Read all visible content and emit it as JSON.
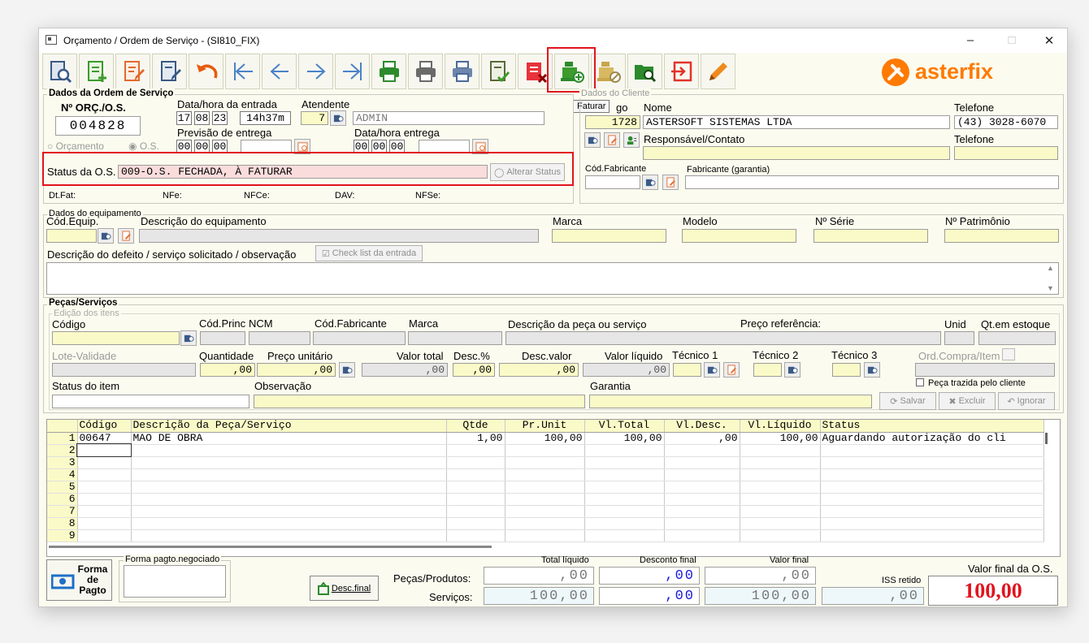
{
  "window": {
    "title": "Orçamento / Ordem de Serviço - (SI810_FIX)"
  },
  "toolbar": {
    "buttons": [
      "search-doc",
      "new-doc",
      "edit-doc",
      "save-doc",
      "undo",
      "first",
      "prev",
      "next",
      "last",
      "print-green",
      "print-gray",
      "print-blue",
      "check-doc",
      "delete-doc",
      "faturar",
      "cancel-billing",
      "search-folder",
      "exit",
      "pencil"
    ],
    "tooltip": "Faturar"
  },
  "brand": {
    "name": "asterfix",
    "color": "#ff7a00"
  },
  "os": {
    "group_title": "Dados da Ordem de Serviço",
    "number_label": "Nº ORÇ./O.S.",
    "number": "004828",
    "radio_orcamento": "Orçamento",
    "radio_os": "O.S.",
    "entry_label": "Data/hora da entrada",
    "entry_day": "17",
    "entry_month": "08",
    "entry_year": "23",
    "entry_time": "14h37m",
    "atendente_label": "Atendente",
    "atendente_code": "7",
    "atendente_name": "ADMIN",
    "previsao_label": "Previsão de entrega",
    "previsao_day": "00",
    "previsao_month": "00",
    "previsao_year": "00",
    "entrega_label": "Data/hora entrega",
    "entrega_day": "00",
    "entrega_month": "00",
    "entrega_year": "00",
    "status_label": "Status da O.S.",
    "status_value": "009-O.S. FECHADA, À FATURAR",
    "alterar_status": "Alterar Status",
    "dtfat_label": "Dt.Fat:",
    "nfe_label": "NFe:",
    "nfce_label": "NFCe:",
    "dav_label": "DAV:",
    "nfse_label": "NFSe:"
  },
  "cliente": {
    "group_title": "Dados do Cliente",
    "codigo_label": "Código",
    "codigo_label_visible": "go",
    "codigo": "1728",
    "nome_label": "Nome",
    "nome": "ASTERSOFT SISTEMAS LTDA",
    "telefone_label": "Telefone",
    "telefone": "(43) 3028-6070",
    "responsavel_label": "Responsável/Contato",
    "telefone2_label": "Telefone",
    "cod_fabricante_label": "Cód.Fabricante",
    "fabricante_label": "Fabricante (garantia)"
  },
  "equipamento": {
    "group_title": "Dados do equipamento",
    "cod_label": "Cód.Equip.",
    "descricao_label": "Descrição do equipamento",
    "marca_label": "Marca",
    "modelo_label": "Modelo",
    "serie_label": "Nº Série",
    "patrimonio_label": "Nº Patrimônio",
    "defeito_label": "Descrição do defeito / serviço solicitado / observação",
    "checklist_button": "Check list da entrada"
  },
  "pecas": {
    "group_title": "Peças/Serviços",
    "edicao_title": "Edição dos itens",
    "codigo_label": "Código",
    "cod_princ_label": "Cód.Princ",
    "ncm_label": "NCM",
    "cod_fabricante_label": "Cód.Fabricante",
    "marca_label": "Marca",
    "descricao_label": "Descrição da peça ou serviço",
    "preco_ref_label": "Preço referência:",
    "unid_label": "Unid",
    "estoque_label": "Qt.em estoque",
    "lote_label": "Lote-Validade",
    "quantidade_label": "Quantidade",
    "quantidade": ",00",
    "preco_unit_label": "Preço unitário",
    "preco_unit": ",00",
    "valor_total_label": "Valor total",
    "valor_total": ",00",
    "desc_pct_label": "Desc.%",
    "desc_pct": ",00",
    "desc_valor_label": "Desc.valor",
    "desc_valor": ",00",
    "valor_liquido_label": "Valor líquido",
    "valor_liquido": ",00",
    "tecnico1_label": "Técnico 1",
    "tecnico2_label": "Técnico 2",
    "tecnico3_label": "Técnico 3",
    "ord_compra_label": "Ord.Compra/Item",
    "status_item_label": "Status do item",
    "observacao_label": "Observação",
    "garantia_label": "Garantia",
    "peca_cliente_label": "Peça trazida pelo cliente",
    "salvar": "Salvar",
    "excluir": "Excluir",
    "ignorar": "Ignorar"
  },
  "grid": {
    "columns": [
      "Código",
      "Descrição da Peça/Serviço",
      "Qtde",
      "Pr.Unit",
      "Vl.Total",
      "Vl.Desc.",
      "Vl.Líquido",
      "Status"
    ],
    "rows": [
      {
        "n": "1",
        "codigo": "00647",
        "descricao": "MAO DE OBRA",
        "qtde": "1,00",
        "pr_unit": "100,00",
        "vl_total": "100,00",
        "vl_desc": ",00",
        "vl_liquido": "100,00",
        "status": "Aguardando autorização do cli"
      },
      {
        "n": "2",
        "codigo": "",
        "descricao": "",
        "qtde": "",
        "pr_unit": "",
        "vl_total": "",
        "vl_desc": "",
        "vl_liquido": "",
        "status": ""
      },
      {
        "n": "3",
        "codigo": "",
        "descricao": "",
        "qtde": "",
        "pr_unit": "",
        "vl_total": "",
        "vl_desc": "",
        "vl_liquido": "",
        "status": ""
      },
      {
        "n": "4",
        "codigo": "",
        "descricao": "",
        "qtde": "",
        "pr_unit": "",
        "vl_total": "",
        "vl_desc": "",
        "vl_liquido": "",
        "status": ""
      },
      {
        "n": "5",
        "codigo": "",
        "descricao": "",
        "qtde": "",
        "pr_unit": "",
        "vl_total": "",
        "vl_desc": "",
        "vl_liquido": "",
        "status": ""
      },
      {
        "n": "6",
        "codigo": "",
        "descricao": "",
        "qtde": "",
        "pr_unit": "",
        "vl_total": "",
        "vl_desc": "",
        "vl_liquido": "",
        "status": ""
      },
      {
        "n": "7",
        "codigo": "",
        "descricao": "",
        "qtde": "",
        "pr_unit": "",
        "vl_total": "",
        "vl_desc": "",
        "vl_liquido": "",
        "status": ""
      },
      {
        "n": "8",
        "codigo": "",
        "descricao": "",
        "qtde": "",
        "pr_unit": "",
        "vl_total": "",
        "vl_desc": "",
        "vl_liquido": "",
        "status": ""
      },
      {
        "n": "9",
        "codigo": "",
        "descricao": "",
        "qtde": "",
        "pr_unit": "",
        "vl_total": "",
        "vl_desc": "",
        "vl_liquido": "",
        "status": ""
      }
    ]
  },
  "footer": {
    "forma_pagto_line1": "Forma",
    "forma_pagto_line2": "de",
    "forma_pagto_line3": "Pagto",
    "forma_negociado_label": "Forma pagto.negociado",
    "desc_final_button": "Desc.final",
    "total_liquido_label": "Total líquido",
    "desconto_final_label": "Desconto final",
    "valor_final_label": "Valor final",
    "pecas_label": "Peças/Produtos:",
    "servicos_label": "Serviços:",
    "pecas_total_liquido": ",00",
    "pecas_desconto": ",00",
    "pecas_valor_final": ",00",
    "servicos_total_liquido": "100,00",
    "servicos_desconto": ",00",
    "servicos_valor_final": "100,00",
    "iss_label": "ISS retido",
    "iss_value": ",00",
    "valor_final_os_label": "Valor final da O.S.",
    "valor_final_os": "100,00"
  }
}
